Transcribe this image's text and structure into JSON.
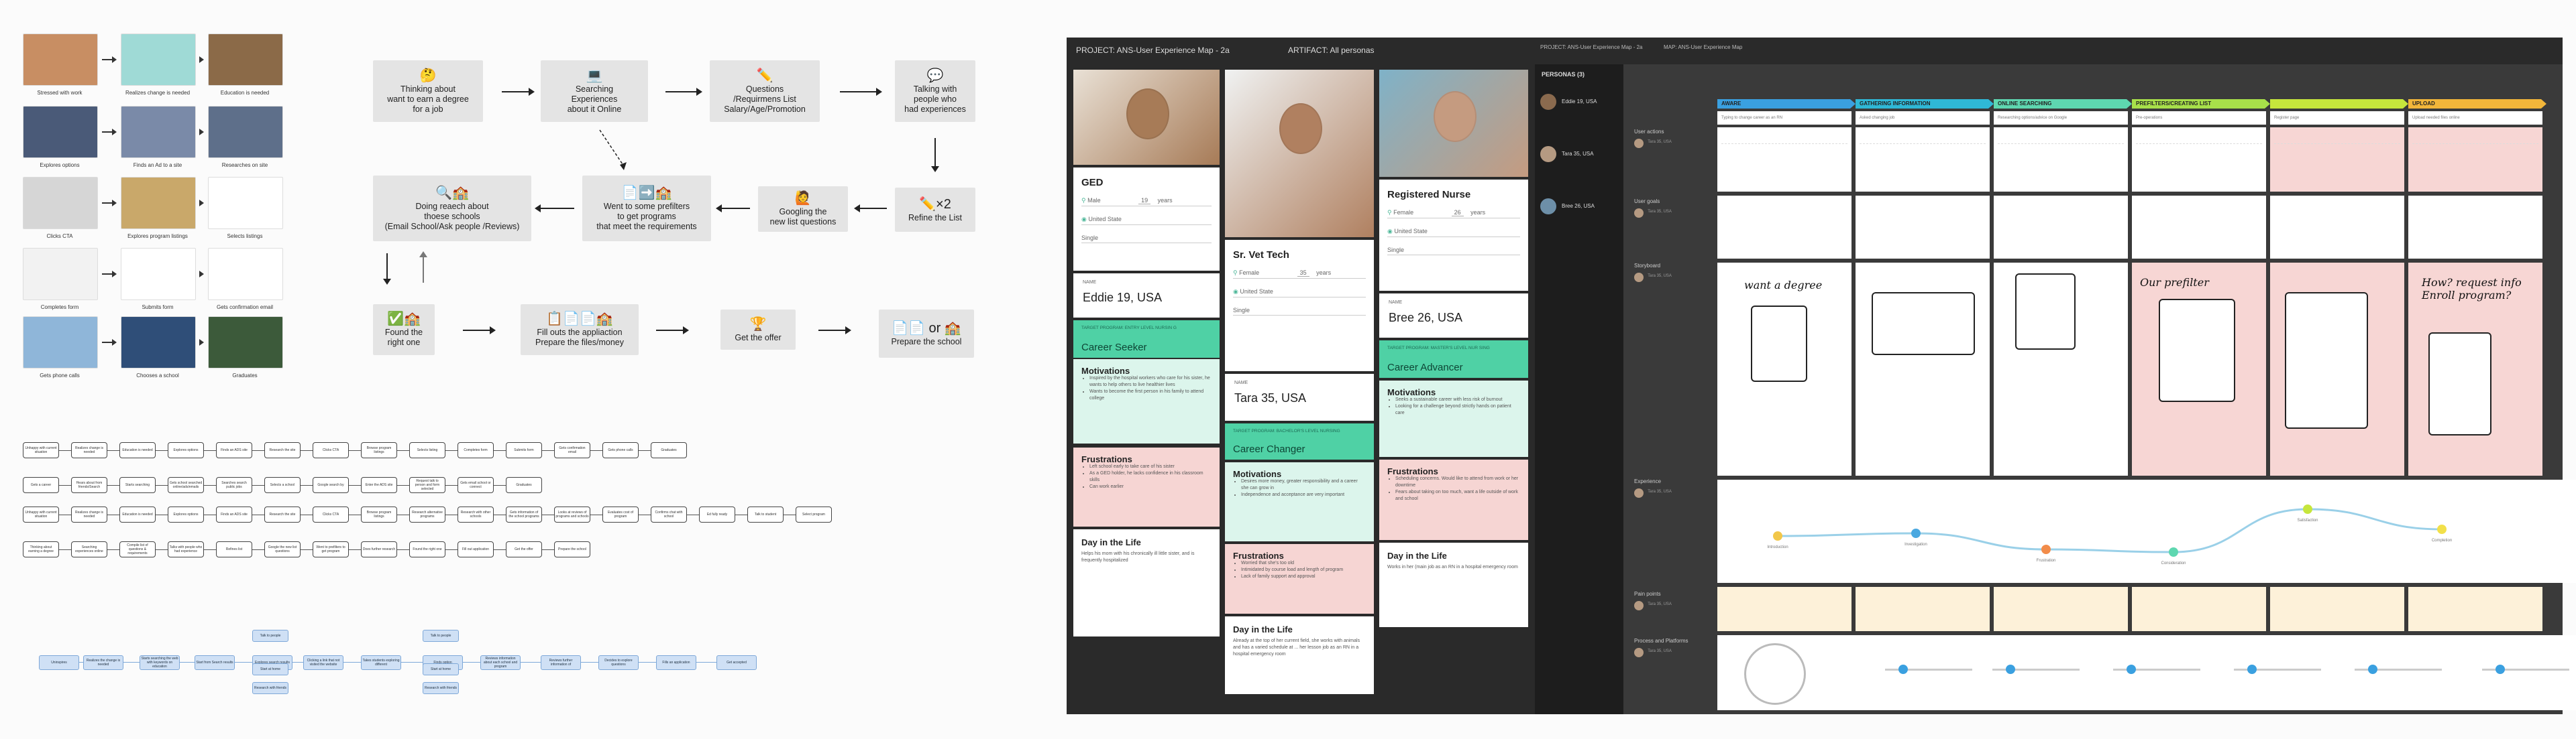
{
  "images_panel": [
    {
      "label": "Stressed with work",
      "color": "#c88e63"
    },
    {
      "label": "Realizes change is needed",
      "color": "#9fdad6"
    },
    {
      "label": "Education is needed",
      "color": "#8b6a48"
    },
    {
      "label": "Explores options",
      "color": "#4a5a78"
    },
    {
      "label": "Finds an Ad to a site",
      "color": "#7a8aa8"
    },
    {
      "label": "Researches on site",
      "color": "#5e6f8a"
    },
    {
      "label": "Clicks CTA",
      "color": "#d6d6d6"
    },
    {
      "label": "Explores program listings",
      "color": "#c9a86a"
    },
    {
      "label": "Selects listings",
      "color": "#ffffff"
    },
    {
      "label": "Completes form",
      "color": "#f2f2f2"
    },
    {
      "label": "Submits form",
      "color": "#ffffff"
    },
    {
      "label": "Gets confirmation email",
      "color": "#ffffff"
    },
    {
      "label": "Gets phone calls",
      "color": "#8fb6d9"
    },
    {
      "label": "Chooses a school",
      "color": "#2f4e78"
    },
    {
      "label": "Graduates",
      "color": "#3c5a3a"
    }
  ],
  "journey": {
    "b1": {
      "icon": "🤔",
      "lines": [
        "Thinking about",
        "want to earn a degree",
        "for a job"
      ]
    },
    "b2": {
      "icon": "💻",
      "lines": [
        "Searching",
        "Experiences",
        "about it Online"
      ]
    },
    "b3": {
      "icon": "✏️",
      "lines": [
        "Questions",
        "/Requirmens List",
        "Salary/Age/Promotion"
      ]
    },
    "b4": {
      "icon": "💬",
      "lines": [
        "Talking with",
        "people who",
        "had experiences"
      ]
    },
    "b5": {
      "icon": "✏️×2",
      "lines": [
        "Refine the List"
      ]
    },
    "b6": {
      "icon": "🙋",
      "lines": [
        "Googling the",
        "new list questions"
      ]
    },
    "b7": {
      "icon": "📄➡️🏫",
      "lines": [
        "Went to some prefilters",
        "to get programs",
        "that meet the requirements"
      ]
    },
    "b8": {
      "icon": "🔍🏫",
      "lines": [
        "Doing reaech about",
        "thoese schools",
        "(Email School/Ask people /Reviews)"
      ]
    },
    "b9": {
      "icon": "✅🏫",
      "lines": [
        "Found the",
        "right one"
      ]
    },
    "b10": {
      "icon": "📋📄📄🏫",
      "lines": [
        "Fill outs the appliaction",
        "Prepare the files/money"
      ]
    },
    "b11": {
      "icon": "🏆",
      "lines": [
        "Get the offer"
      ]
    },
    "b12": {
      "icon": "📄📄 or 🏫",
      "lines": [
        "Prepare the school"
      ]
    }
  },
  "flow_rows": [
    [
      "Unhappy with current situation",
      "Realizes change is needed",
      "Education is needed",
      "Explores options",
      "Finds an ADS site",
      "Research the site",
      "Clicks CTA",
      "Browse program listings",
      "Selects listing",
      "Completes form",
      "Submits form",
      "Gets confirmation email",
      "Gets phone calls",
      "Graduates"
    ],
    [
      "Gets a career",
      "Hears about from friends/Search",
      "Starts searching",
      "Gets school searched online/ads/emails",
      "Searches search public jobs",
      "Selects a school",
      "Google search by",
      "Enter the ADS site",
      "Request talk to person and form selected",
      "Gets email school or connect",
      "Graduates"
    ],
    [
      "Unhappy with current situation",
      "Realizes change is needed",
      "Education is needed",
      "Explores options",
      "Finds an ADS site",
      "Research the site",
      "Clicks CTA",
      "Browse program listings",
      "Research alternative programs",
      "Research with other schools",
      "Gets information of the school programs",
      "Looks at reviews of programs and schools",
      "Evaluates cost of program",
      "Confirms chat with school",
      "Ed fully ready",
      "Talk to student",
      "Select program"
    ],
    [
      "Thinking about earning a degree",
      "Searching experiences online",
      "Compile list of questions & requirements",
      "Talks with people who had experience",
      "Refines list",
      "Google the new list questions",
      "Went to prefilters to get program",
      "Does further research",
      "Found the right one",
      "Fill out application",
      "Get the offer",
      "Prepare the school"
    ]
  ],
  "blue_flow": {
    "main": [
      "Uninspires",
      "Realizes the change is needed",
      "Starts searching the web with keywords on education",
      "Start from Search results",
      "Explores search results",
      "Clicking a link that not visited the website",
      "Takes students exploring different",
      "Finds option",
      "Reviews information about each school and program",
      "Reviews further information of",
      "Decides to explore questions",
      "Fills an application",
      "Get accepted"
    ],
    "branch_a": [
      "Talk to people",
      "Talk to people"
    ],
    "branch_b": [
      "Start at home",
      "Start at home"
    ],
    "branch_c": [
      "Research with friends",
      "Research with friends"
    ]
  },
  "board": {
    "header_left": "PROJECT: ANS-User Experience Map - 2a",
    "header_artifact": "ARTIFACT: All personas",
    "header_right_project": "PROJECT: ANS-User Experience Map - 2a",
    "header_right_map": "MAP: ANS-User Experience Map",
    "personas_title": "PERSONAS (3)",
    "persona_list": [
      "Eddie 19, USA",
      "Tara 35, USA",
      "Bree 26, USA"
    ],
    "personas": [
      {
        "title": "GED",
        "gender": "Male",
        "age": "19",
        "years": "years",
        "location": "United State",
        "status": "Single",
        "name_label": "NAME",
        "name": "Eddie 19, USA",
        "target_label": "TARGET PROGRAM: ENTRY LEVEL NURSIN G",
        "target": "Career Seeker",
        "motivations_title": "Motivations",
        "motivations": [
          "Inspired by the hospital workers who care for his sister, he wants to help others to live healthier lives",
          "Wants to become the first person in his family to attend college"
        ],
        "frustrations_title": "Frustrations",
        "frustrations": [
          "Left school early to take care of his sister",
          "As a GED holder, he lacks confidence in his classroom skills",
          "Can work earlier"
        ],
        "day_title": "Day in the Life",
        "day": "Helps his mom with his chronically ill little sister, and is frequently hospitalized"
      },
      {
        "title": "Sr. Vet Tech",
        "gender": "Female",
        "age": "35",
        "years": "years",
        "location": "United State",
        "status": "Single",
        "name_label": "NAME",
        "name": "Tara 35, USA",
        "target_label": "TARGET PROGRAM: BACHELOR'S LEVEL NURSING",
        "target": "Career Changer",
        "motivations_title": "Motivations",
        "motivations": [
          "Desires more money, greater responsibility and a career she can grow in",
          "Independence and acceptance are very important"
        ],
        "frustrations_title": "Frustrations",
        "frustrations": [
          "Worried that she's too old",
          "Intimidated by course load and length of program",
          "Lack of family support and approval"
        ],
        "day_title": "Day in the Life",
        "day": "Already at the top of her current field, she works with animals and has a varied schedule at ... her lesson job as an RN in a hospital emergency room"
      },
      {
        "title": "Registered Nurse",
        "gender": "Female",
        "age": "26",
        "years": "years",
        "location": "United State",
        "status": "Single",
        "name_label": "NAME",
        "name": "Bree 26, USA",
        "target_label": "TARGET PROGRAM: MASTER'S LEVEL NUR SING",
        "target": "Career Advancer",
        "motivations_title": "Motivations",
        "motivations": [
          "Seeks a sustainable career with less risk of burnout",
          "Looking for a challenge beyond strictly hands on patient care"
        ],
        "frustrations_title": "Frustrations",
        "frustrations": [
          "Scheduling concerns. Would like to attend from work or her downtime",
          "Fears about taking on too much, want a life outside of work and school"
        ],
        "day_title": "Day in the Life",
        "day": "Works in her (main job as an RN in a hospital emergency room"
      }
    ],
    "row_labels": [
      "User actions",
      "User goals",
      "Storyboard",
      "Experience",
      "Pain points",
      "Process and Platforms"
    ],
    "row_user": "Tara 35, USA",
    "stages": [
      {
        "name": "AWARE",
        "color": "#3aa0e0"
      },
      {
        "name": "GATHERING INFORMATION",
        "color": "#2fb8d6"
      },
      {
        "name": "ONLINE SEARCHING",
        "color": "#5ed7b0"
      },
      {
        "name": "PREFILTERS/CREATING LIST",
        "color": "#a8e04a"
      },
      {
        "name": "",
        "color": "#c6e63c"
      },
      {
        "name": "UPLOAD",
        "color": "#f2b63a"
      }
    ],
    "actions": [
      "Typing to change career as an RN",
      "Asked changing job",
      "Researching options/advice on Google",
      "Pre-operations",
      "Register page",
      "Upload needed files online"
    ],
    "storyboard_text": [
      "want a degree",
      "Our prefilter",
      "How? request info Enroll program?"
    ],
    "experience_points": [
      "Introduction",
      "Investigation",
      "Frustration",
      "Consideration",
      "Satisfaction",
      "Completion"
    ]
  }
}
